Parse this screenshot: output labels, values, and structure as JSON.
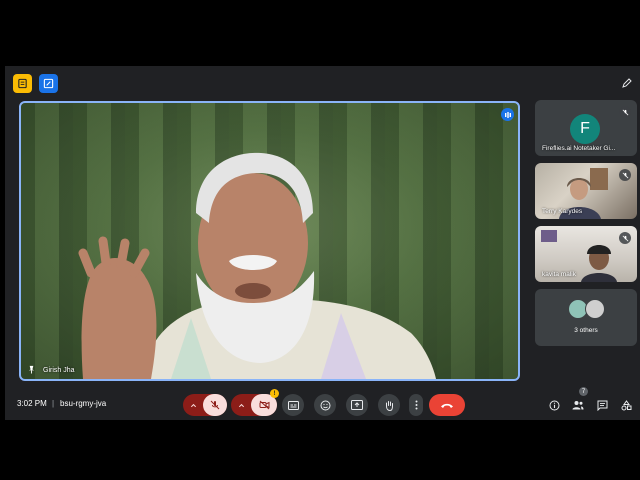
{
  "main_speaker": {
    "name": "Girish Jha"
  },
  "participants": [
    {
      "name": "Fireflies.ai Notetaker Gi...",
      "avatar_letter": "F",
      "avatar_color": "#12857a"
    },
    {
      "name": "Terry Karydes"
    },
    {
      "name": "kavita malik"
    }
  ],
  "others_tile": {
    "label": "3 others"
  },
  "meeting": {
    "time": "3:02 PM",
    "separator": "|",
    "code": "bsu-rgmy-jva"
  },
  "people_count": "7",
  "camera_warning": "!",
  "colors": {
    "accent": "#8ab4f8",
    "leave": "#ea4335",
    "muted_bg": "#f9dedc",
    "notes": "#fbbc04",
    "activity": "#1a73e8"
  },
  "icons": {
    "top_left": [
      "notes-icon",
      "activity-icon"
    ],
    "top_right": "pen-icon",
    "controls": [
      "chevron-up-icon",
      "mic-off-icon",
      "chevron-up-icon",
      "camera-off-icon",
      "captions-icon",
      "emoji-icon",
      "present-icon",
      "raise-hand-icon",
      "more-vert-icon",
      "call-end-icon"
    ],
    "right": [
      "info-icon",
      "people-icon",
      "chat-icon",
      "tools-icon"
    ]
  }
}
